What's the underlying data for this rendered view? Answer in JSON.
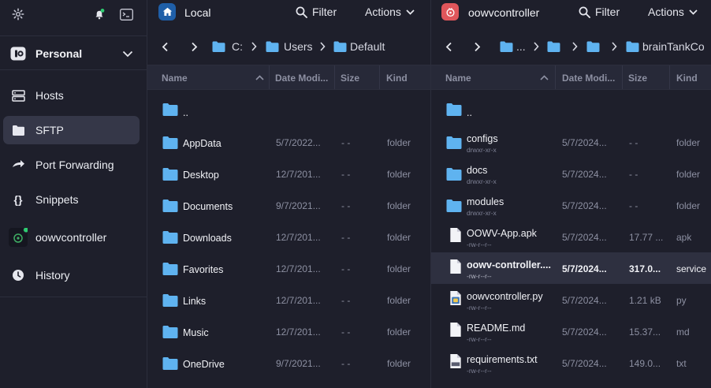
{
  "sidebar": {
    "vault_name": "Personal",
    "items": [
      {
        "label": "Hosts",
        "icon": "server-icon"
      },
      {
        "label": "SFTP",
        "icon": "folder-icon",
        "active": true
      },
      {
        "label": "Port Forwarding",
        "icon": "port-forward-icon"
      },
      {
        "label": "Snippets",
        "icon": "braces-icon"
      },
      {
        "label": "oowvcontroller",
        "icon": "host-avatar-icon",
        "status": "online"
      },
      {
        "label": "History",
        "icon": "clock-icon"
      }
    ]
  },
  "left_panel": {
    "title": "Local",
    "filter_label": "Filter",
    "actions_label": "Actions",
    "breadcrumb": [
      "C:",
      "Users",
      "Default"
    ],
    "columns": [
      "Name",
      "Date Modi...",
      "Size",
      "Kind"
    ],
    "rows": [
      {
        "name": "..",
        "date": "",
        "size": "",
        "kind": ""
      },
      {
        "name": "AppData",
        "date": "5/7/2022...",
        "size": "- -",
        "kind": "folder"
      },
      {
        "name": "Desktop",
        "date": "12/7/201...",
        "size": "- -",
        "kind": "folder"
      },
      {
        "name": "Documents",
        "date": "9/7/2021...",
        "size": "- -",
        "kind": "folder"
      },
      {
        "name": "Downloads",
        "date": "12/7/201...",
        "size": "- -",
        "kind": "folder"
      },
      {
        "name": "Favorites",
        "date": "12/7/201...",
        "size": "- -",
        "kind": "folder"
      },
      {
        "name": "Links",
        "date": "12/7/201...",
        "size": "- -",
        "kind": "folder"
      },
      {
        "name": "Music",
        "date": "12/7/201...",
        "size": "- -",
        "kind": "folder"
      },
      {
        "name": "OneDrive",
        "date": "9/7/2021...",
        "size": "- -",
        "kind": "folder"
      }
    ]
  },
  "right_panel": {
    "title": "oowvcontroller",
    "filter_label": "Filter",
    "actions_label": "Actions",
    "breadcrumb": [
      "...",
      "",
      "",
      "brainTankCo"
    ],
    "columns": [
      "Name",
      "Date Modi...",
      "Size",
      "Kind"
    ],
    "rows": [
      {
        "name": "..",
        "perm": "",
        "date": "",
        "size": "",
        "kind": "",
        "type": "folder"
      },
      {
        "name": "configs",
        "perm": "drwxr-xr-x",
        "date": "5/7/2024...",
        "size": "- -",
        "kind": "folder",
        "type": "folder"
      },
      {
        "name": "docs",
        "perm": "drwxr-xr-x",
        "date": "5/7/2024...",
        "size": "- -",
        "kind": "folder",
        "type": "folder"
      },
      {
        "name": "modules",
        "perm": "drwxr-xr-x",
        "date": "5/7/2024...",
        "size": "- -",
        "kind": "folder",
        "type": "folder"
      },
      {
        "name": "OOWV-App.apk",
        "perm": "-rw-r--r--",
        "date": "5/7/2024...",
        "size": "17.77 ...",
        "kind": "apk",
        "type": "file"
      },
      {
        "name": "oowv-controller....",
        "perm": "-rw-r--r--",
        "date": "5/7/2024...",
        "size": "317.0...",
        "kind": "service",
        "type": "file",
        "selected": true
      },
      {
        "name": "oowvcontroller.py",
        "perm": "-rw-r--r--",
        "date": "5/7/2024...",
        "size": "1.21 kB",
        "kind": "py",
        "type": "py"
      },
      {
        "name": "README.md",
        "perm": "-rw-r--r--",
        "date": "5/7/2024...",
        "size": "15.37...",
        "kind": "md",
        "type": "file"
      },
      {
        "name": "requirements.txt",
        "perm": "-rw-r--r--",
        "date": "5/7/2024...",
        "size": "149.0...",
        "kind": "txt",
        "type": "txt"
      }
    ]
  },
  "colors": {
    "background": "#1e1f2b",
    "folder": "#5fb3f0",
    "local_badge": "#1f5fa8",
    "remote_badge": "#e0565b",
    "online": "#2ecc71"
  }
}
